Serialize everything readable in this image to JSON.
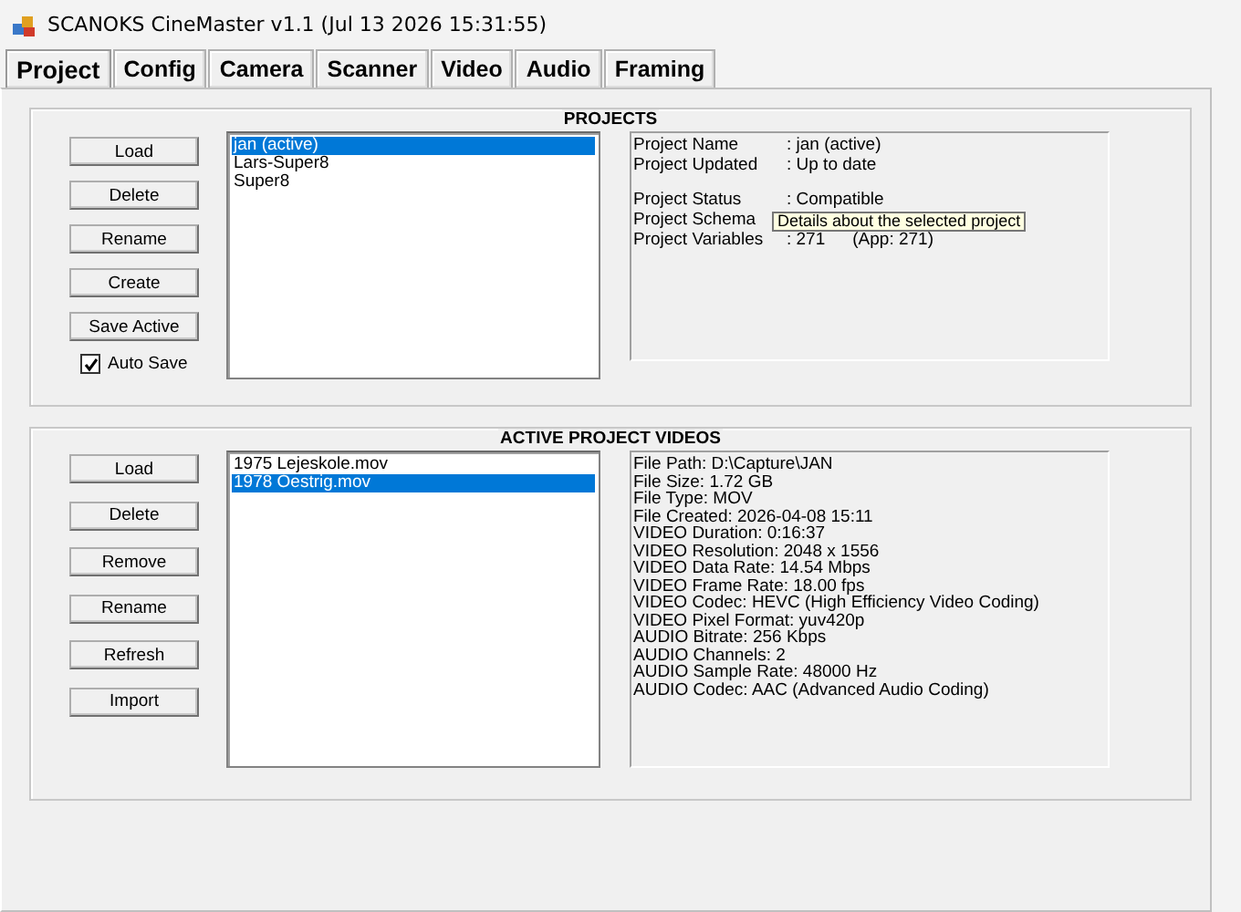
{
  "window": {
    "title": "SCANOKS CineMaster v1.1 (Jul 13 2026 15:31:55)"
  },
  "tabs": [
    {
      "label": "Project",
      "selected": true
    },
    {
      "label": "Config",
      "selected": false
    },
    {
      "label": "Camera",
      "selected": false
    },
    {
      "label": "Scanner",
      "selected": false
    },
    {
      "label": "Video",
      "selected": false
    },
    {
      "label": "Audio",
      "selected": false
    },
    {
      "label": "Framing",
      "selected": false
    }
  ],
  "projects": {
    "title": "PROJECTS",
    "buttons": [
      "Load",
      "Delete",
      "Rename",
      "Create",
      "Save Active"
    ],
    "auto_save": {
      "label": "Auto Save",
      "checked": true
    },
    "list": [
      {
        "label": "jan (active)",
        "selected": true
      },
      {
        "label": "Lars-Super8",
        "selected": false
      },
      {
        "label": "Super8",
        "selected": false
      }
    ],
    "details": [
      [
        {
          "label": "Project Name",
          "value": ": jan (active)"
        },
        {
          "label": "Project Updated",
          "value": ": Up to date"
        }
      ],
      [
        {
          "label": "Project Status",
          "value": ": Compatible"
        },
        {
          "label": "Project Schema",
          "tooltip": "Details about the selected project"
        },
        {
          "label": "Project Variables",
          "value": ": 271",
          "extra": "(App:   271)"
        }
      ]
    ]
  },
  "videos": {
    "title": "ACTIVE PROJECT VIDEOS",
    "buttons": [
      "Load",
      "Delete",
      "Remove",
      "Rename",
      "Refresh",
      "Import"
    ],
    "list": [
      {
        "label": "1975 Lejeskole.mov",
        "selected": false
      },
      {
        "label": "1978 Oestrig.mov",
        "selected": true
      }
    ],
    "details": [
      "File Path: D:\\Capture\\JAN",
      "File Size: 1.72 GB",
      "File Type: MOV",
      "File Created: 2026-04-08 15:11",
      "VIDEO Duration: 0:16:37",
      "VIDEO Resolution: 2048 x 1556",
      "VIDEO Data Rate: 14.54 Mbps",
      "VIDEO Frame Rate: 18.00 fps",
      "VIDEO Codec: HEVC (High Efficiency Video Coding)",
      "VIDEO Pixel Format: yuv420p",
      "AUDIO Bitrate: 256 Kbps",
      "AUDIO Channels: 2",
      "AUDIO Sample Rate: 48000 Hz",
      "AUDIO Codec: AAC (Advanced Audio Coding)"
    ]
  }
}
